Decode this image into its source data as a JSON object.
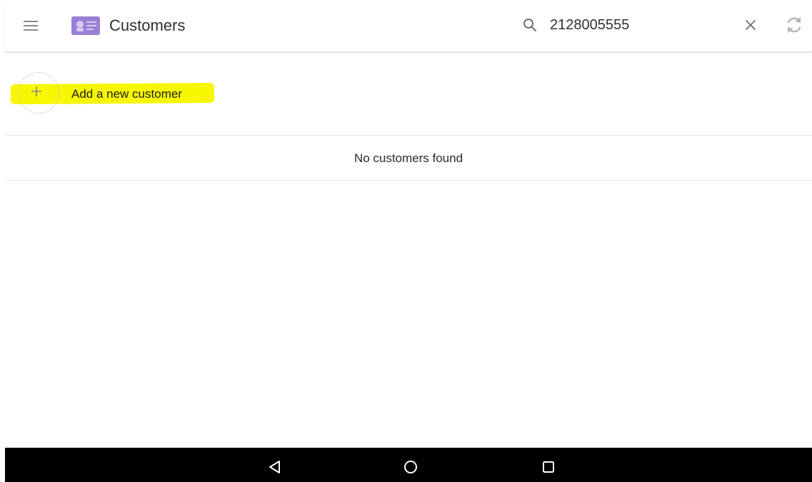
{
  "header": {
    "title": "Customers",
    "menu_icon": "hamburger-menu-icon",
    "app_icon": "customer-card-icon",
    "search_icon": "search-icon",
    "clear_icon": "close-icon",
    "sync_icon": "sync-icon"
  },
  "search": {
    "value": "2128005555",
    "placeholder": ""
  },
  "add_customer": {
    "label": "Add a new customer",
    "icon": "plus-icon",
    "highlight_color": "#f7f700"
  },
  "results": {
    "empty_message": "No customers found"
  },
  "navigation": {
    "back_icon": "back-triangle-icon",
    "home_icon": "home-circle-icon",
    "recents_icon": "recents-square-icon"
  },
  "colors": {
    "app_icon_accent": "#9b7fd6",
    "nav_background": "#000000",
    "highlight": "#f7f700"
  }
}
